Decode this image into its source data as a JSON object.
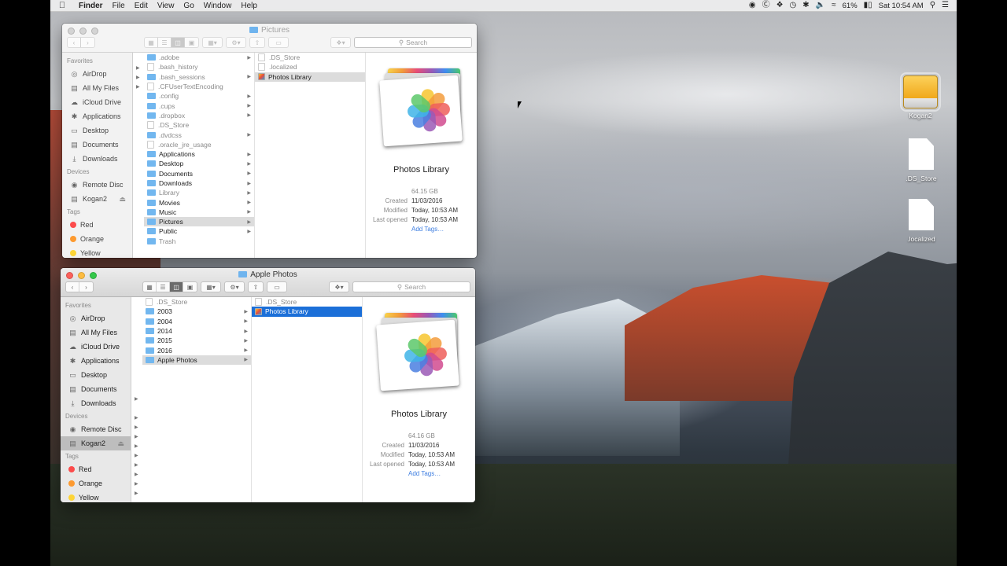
{
  "menubar": {
    "app_name": "Finder",
    "menus": [
      "File",
      "Edit",
      "View",
      "Go",
      "Window",
      "Help"
    ],
    "battery": "61%",
    "clock": "Sat 10:54 AM"
  },
  "windows": [
    {
      "title": "Pictures",
      "search_placeholder": "Search",
      "sidebar": {
        "favorites_header": "Favorites",
        "favorites": [
          "AirDrop",
          "All My Files",
          "iCloud Drive",
          "Applications",
          "Desktop",
          "Documents",
          "Downloads"
        ],
        "devices_header": "Devices",
        "devices": [
          "Remote Disc",
          "Kogan2"
        ],
        "tags_header": "Tags",
        "tags": [
          {
            "name": "Red",
            "color": "#fc4b4b"
          },
          {
            "name": "Orange",
            "color": "#fd9a30"
          },
          {
            "name": "Yellow",
            "color": "#fdd436"
          }
        ]
      },
      "column1": [
        ".adobe",
        ".bash_history",
        ".bash_sessions",
        ".CFUserTextEncoding",
        ".config",
        ".cups",
        ".dropbox",
        ".DS_Store",
        ".dvdcss",
        ".oracle_jre_usage",
        "Applications",
        "Desktop",
        "Documents",
        "Downloads",
        "Library",
        "Movies",
        "Music",
        "Pictures",
        "Public",
        "Trash"
      ],
      "column2": [
        ".DS_Store",
        ".localized",
        "Photos Library"
      ],
      "preview": {
        "name": "Photos Library",
        "size": "64.15 GB",
        "created_label": "Created",
        "created": "11/03/2016",
        "modified_label": "Modified",
        "modified": "Today, 10:53 AM",
        "opened_label": "Last opened",
        "opened": "Today, 10:53 AM",
        "tags_link": "Add Tags…"
      }
    },
    {
      "title": "Apple Photos",
      "search_placeholder": "Search",
      "sidebar": {
        "favorites_header": "Favorites",
        "favorites": [
          "AirDrop",
          "All My Files",
          "iCloud Drive",
          "Applications",
          "Desktop",
          "Documents",
          "Downloads"
        ],
        "devices_header": "Devices",
        "devices": [
          "Remote Disc",
          "Kogan2"
        ],
        "tags_header": "Tags",
        "tags": [
          {
            "name": "Red",
            "color": "#fc4b4b"
          },
          {
            "name": "Orange",
            "color": "#fd9a30"
          },
          {
            "name": "Yellow",
            "color": "#fdd436"
          }
        ]
      },
      "column1": [
        ".DS_Store",
        "2003",
        "2004",
        "2014",
        "2015",
        "2016",
        "Apple Photos"
      ],
      "column2": [
        ".DS_Store",
        "Photos Library"
      ],
      "preview": {
        "name": "Photos Library",
        "size": "64.16 GB",
        "created_label": "Created",
        "created": "11/03/2016",
        "modified_label": "Modified",
        "modified": "Today, 10:53 AM",
        "opened_label": "Last opened",
        "opened": "Today, 10:53 AM",
        "tags_link": "Add Tags…"
      }
    }
  ],
  "desktop_icons": [
    "Kogan2",
    ".DS_Store",
    ".localized"
  ]
}
